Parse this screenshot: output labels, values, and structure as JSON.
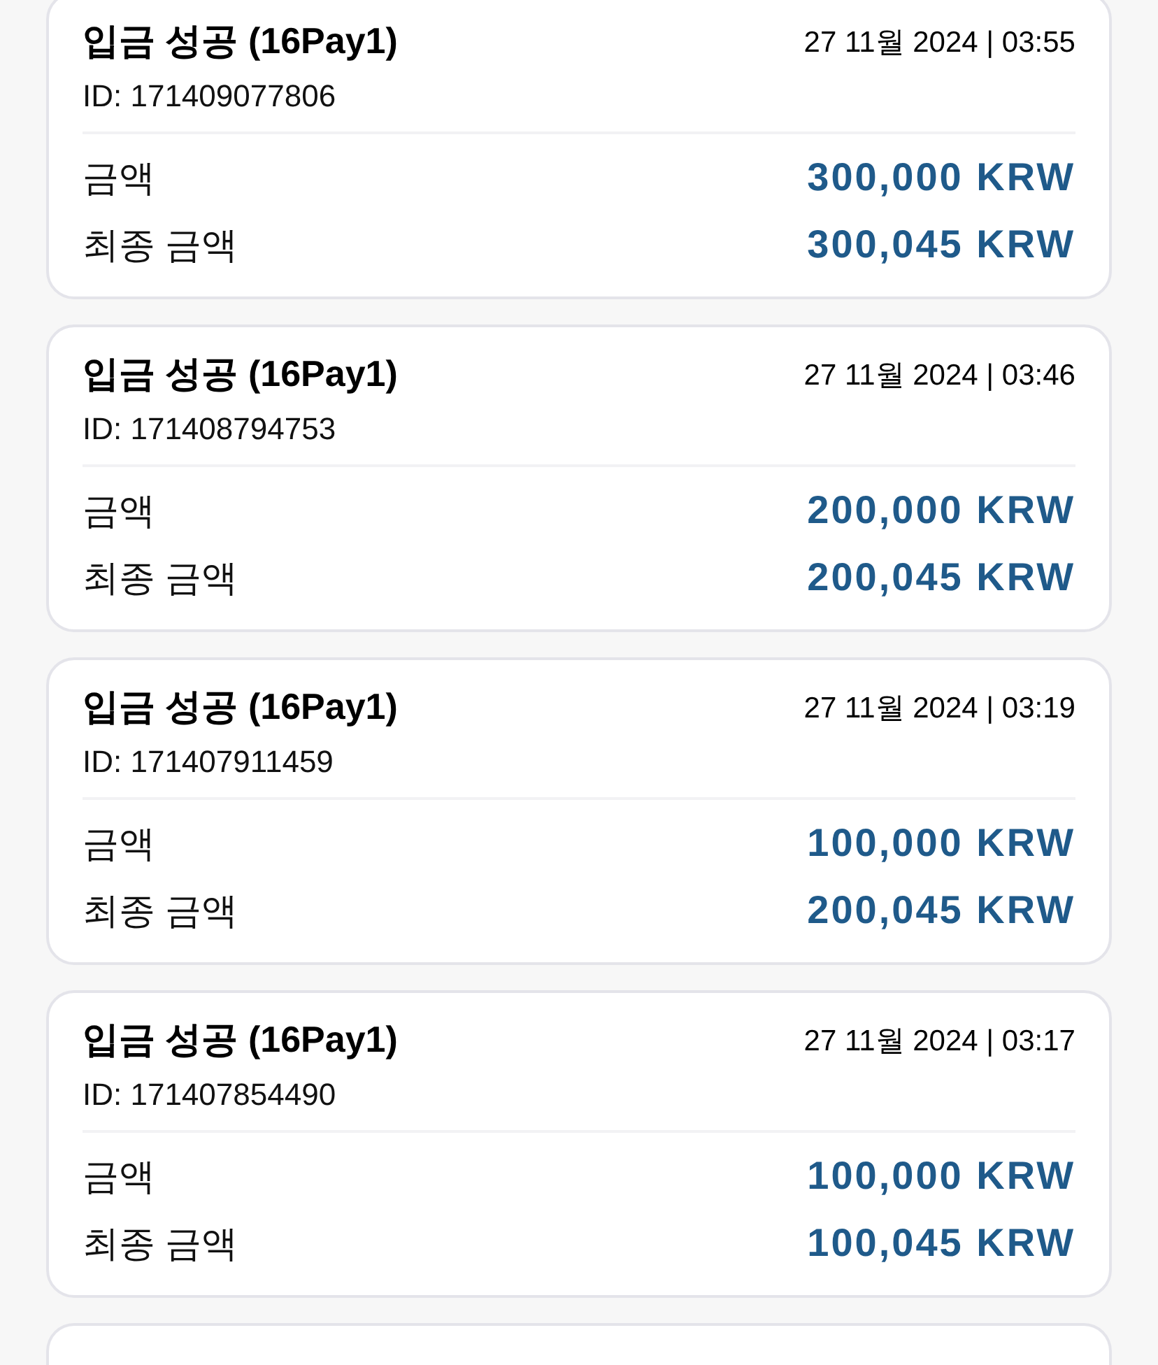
{
  "transactions": [
    {
      "title": "입금 성공 (16Pay1)",
      "datetime": "27 11월 2024 | 03:55",
      "id": "ID: 171409077806",
      "rows": [
        {
          "label": "금액",
          "value": "300,000 KRW"
        },
        {
          "label": "최종 금액",
          "value": "300,045 KRW"
        }
      ]
    },
    {
      "title": "입금 성공 (16Pay1)",
      "datetime": "27 11월 2024 | 03:46",
      "id": "ID: 171408794753",
      "rows": [
        {
          "label": "금액",
          "value": "200,000 KRW"
        },
        {
          "label": "최종 금액",
          "value": "200,045 KRW"
        }
      ]
    },
    {
      "title": "입금 성공 (16Pay1)",
      "datetime": "27 11월 2024 | 03:19",
      "id": "ID: 171407911459",
      "rows": [
        {
          "label": "금액",
          "value": "100,000 KRW"
        },
        {
          "label": "최종 금액",
          "value": "200,045 KRW"
        }
      ]
    },
    {
      "title": "입금 성공 (16Pay1)",
      "datetime": "27 11월 2024 | 03:17",
      "id": "ID: 171407854490",
      "rows": [
        {
          "label": "금액",
          "value": "100,000 KRW"
        },
        {
          "label": "최종 금액",
          "value": "100,045 KRW"
        }
      ]
    }
  ]
}
